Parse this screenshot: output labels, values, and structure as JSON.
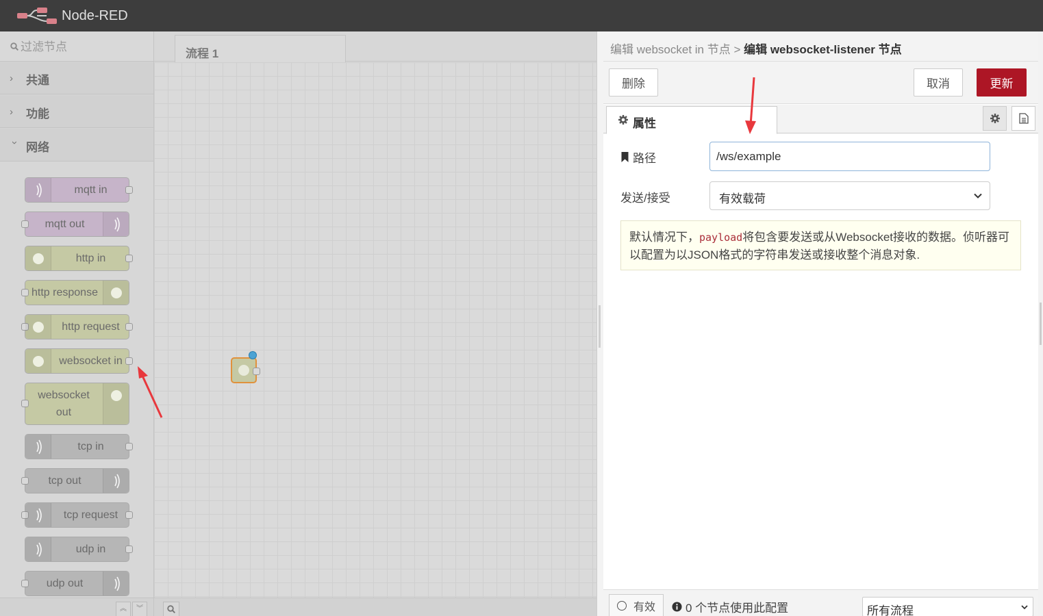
{
  "header": {
    "app_title": "Node-RED"
  },
  "palette": {
    "search_placeholder": "过滤节点",
    "categories": [
      {
        "label": "共通",
        "expanded": false
      },
      {
        "label": "功能",
        "expanded": false
      },
      {
        "label": "网络",
        "expanded": true
      }
    ],
    "nodes": [
      {
        "label": "mqtt in",
        "color": "#c6b4c9"
      },
      {
        "label": "mqtt out",
        "color": "#c6b4c9"
      },
      {
        "label": "http in",
        "color": "#c5c9a4"
      },
      {
        "label": "http response",
        "color": "#c5c9a4"
      },
      {
        "label": "http request",
        "color": "#c5c9a4"
      },
      {
        "label": "websocket in",
        "color": "#c5c9a4"
      },
      {
        "label": "websocket out",
        "color": "#c5c9a4"
      },
      {
        "label": "tcp in",
        "color": "#b6b6b6"
      },
      {
        "label": "tcp out",
        "color": "#b6b6b6"
      },
      {
        "label": "tcp request",
        "color": "#b6b6b6"
      },
      {
        "label": "udp in",
        "color": "#b6b6b6"
      },
      {
        "label": "udp out",
        "color": "#b6b6b6"
      }
    ]
  },
  "workspace": {
    "tab_label": "流程 1"
  },
  "editor": {
    "breadcrumb_parent": "编辑 websocket in 节点 >",
    "breadcrumb_current": "编辑 websocket-listener 节点",
    "delete_label": "删除",
    "cancel_label": "取消",
    "update_label": "更新",
    "properties_tab": "属性",
    "path_label": "路径",
    "path_value": "/ws/example",
    "send_receive_label": "发送/接受",
    "send_receive_value": "有效载荷",
    "tip_prefix": "默认情况下，",
    "tip_code": "payload",
    "tip_suffix": "将包含要发送或从Websocket接收的数据。侦听器可以配置为以JSON格式的字符串发送或接收整个消息对象.",
    "valid_label": "有效",
    "usage_text": "0 个节点使用此配置",
    "scope_value": "所有流程",
    "accent_color": "#ad1625"
  }
}
